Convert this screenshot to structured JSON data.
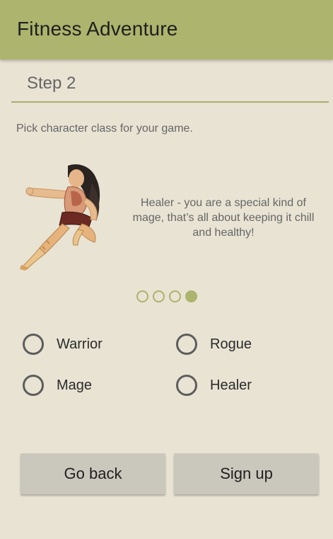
{
  "app": {
    "title": "Fitness Adventure"
  },
  "step": {
    "label": "Step 2"
  },
  "instruction": "Pick character class for your game.",
  "carousel": {
    "description": "Healer - you are a special kind of mage, that’s all about keeping it chill and healthy!",
    "image_icon": "healer-character-illustration",
    "page_count": 4,
    "active_page": 4
  },
  "class_options": [
    {
      "label": "Warrior",
      "selected": false
    },
    {
      "label": "Rogue",
      "selected": false
    },
    {
      "label": "Mage",
      "selected": false
    },
    {
      "label": "Healer",
      "selected": false
    }
  ],
  "buttons": {
    "back": "Go back",
    "signup": "Sign up"
  },
  "colors": {
    "accent": "#acb46d",
    "background": "#e8e3d3",
    "button": "#cac7bc"
  }
}
